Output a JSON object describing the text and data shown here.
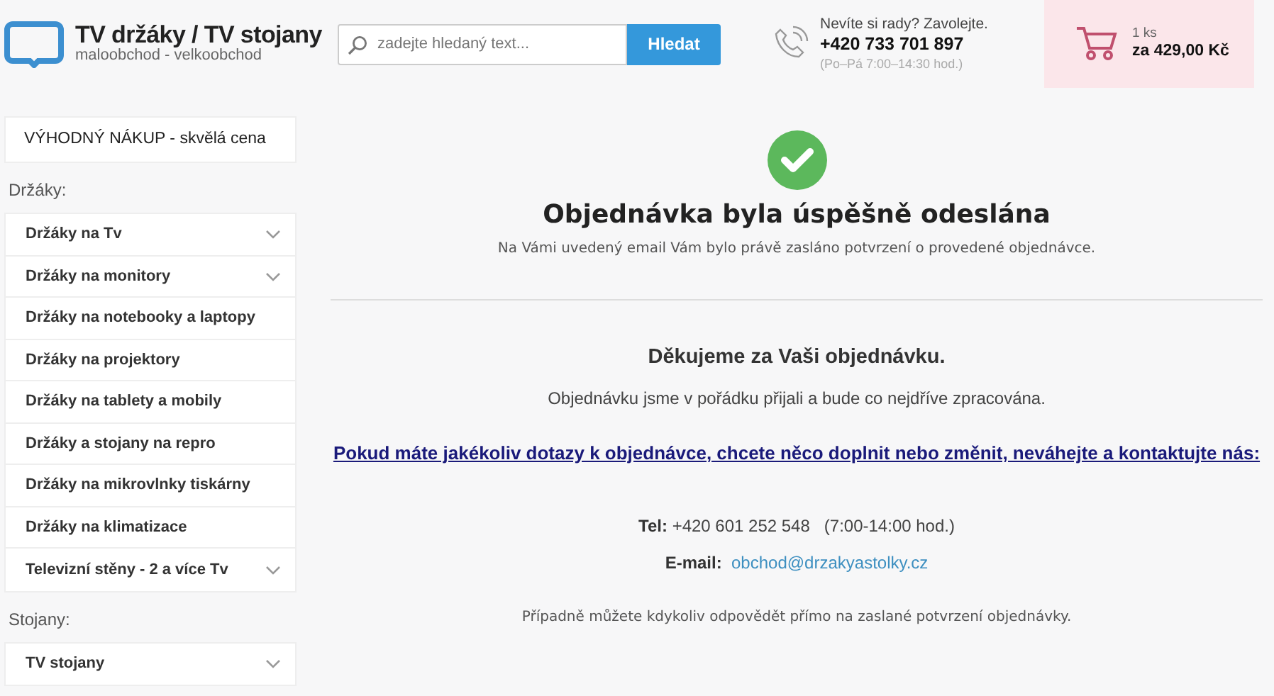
{
  "header": {
    "logo_title": "TV držáky / TV stojany",
    "logo_subtitle": "maloobchod - velkoobchod",
    "search": {
      "placeholder": "zadejte hledaný text...",
      "button": "Hledat"
    },
    "contact": {
      "question": "Nevíte si rady? Zavolejte.",
      "phone": "+420 733 701 897",
      "hours": "(Po–Pá 7:00–14:30 hod.)"
    },
    "cart": {
      "count": "1 ks",
      "total": "za 429,00 Kč"
    }
  },
  "sidebar": {
    "promo": "VÝHODNÝ NÁKUP - skvělá cena",
    "groups": [
      {
        "title": "Držáky:",
        "items": [
          {
            "label": "Držáky na Tv",
            "expandable": true
          },
          {
            "label": "Držáky na monitory",
            "expandable": true
          },
          {
            "label": "Držáky na notebooky a laptopy",
            "expandable": false
          },
          {
            "label": "Držáky na projektory",
            "expandable": false
          },
          {
            "label": "Držáky na tablety a mobily",
            "expandable": false
          },
          {
            "label": "Držáky a stojany na repro",
            "expandable": false
          },
          {
            "label": "Držáky na mikrovlnky tiskárny",
            "expandable": false
          },
          {
            "label": "Držáky na klimatizace",
            "expandable": false
          },
          {
            "label": "Televizní stěny - 2 a více Tv",
            "expandable": true
          }
        ]
      },
      {
        "title": "Stojany:",
        "items": [
          {
            "label": "TV stojany",
            "expandable": true
          }
        ]
      }
    ]
  },
  "main": {
    "heading": "Objednávka byla úspěšně odeslána",
    "subtitle": "Na Vámi uvedený email Vám bylo právě zasláno potvrzení o provedené objednávce.",
    "thanks": "Děkujeme za Vaši objednávku.",
    "received": "Objednávku jsme v pořádku přijali a bude co nejdříve zpracována.",
    "contact_link": "Pokud máte jakékoliv dotazy k objednávce, chcete něco doplnit nebo změnit, neváhejte a kontaktujte nás:",
    "tel_label": "Tel:",
    "tel_value": "+420 601 252 548   (7:00-14:00 hod.)",
    "email_label": "E-mail:",
    "email_value": "obchod@drzakyastolky.cz",
    "footer_note": "Případně můžete kdykoliv odpovědět přímo na zaslané potvrzení objednávky."
  }
}
